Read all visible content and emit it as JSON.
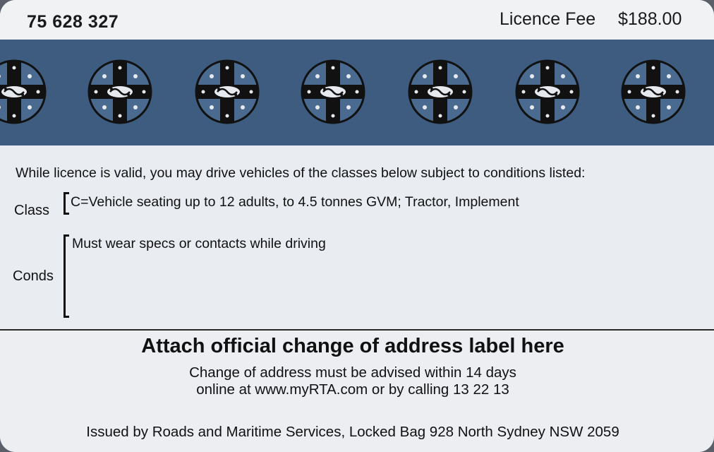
{
  "header": {
    "card_number": "75 628 327",
    "fee_label": "Licence Fee",
    "fee_value": "$188.00"
  },
  "band": {
    "color": "#3d5c80",
    "emblem_icon": "nsw-cross-emblem-icon",
    "emblem_count": 7
  },
  "conditions": {
    "intro": "While licence is valid, you may drive vehicles of the classes below subject to conditions listed:",
    "class_label": "Class",
    "class_text": "C=Vehicle seating up to 12 adults, to 4.5 tonnes GVM; Tractor, Implement",
    "conds_label": "Conds",
    "conds_text": "Must wear specs or contacts while driving"
  },
  "address": {
    "title": "Attach official change of address label here",
    "line1": "Change of address must be advised within 14 days",
    "line2": "online at www.myRTA.com or by calling 13 22 13"
  },
  "footer": {
    "issued": "Issued by Roads and Maritime Services, Locked Bag 928 North Sydney NSW 2059"
  }
}
